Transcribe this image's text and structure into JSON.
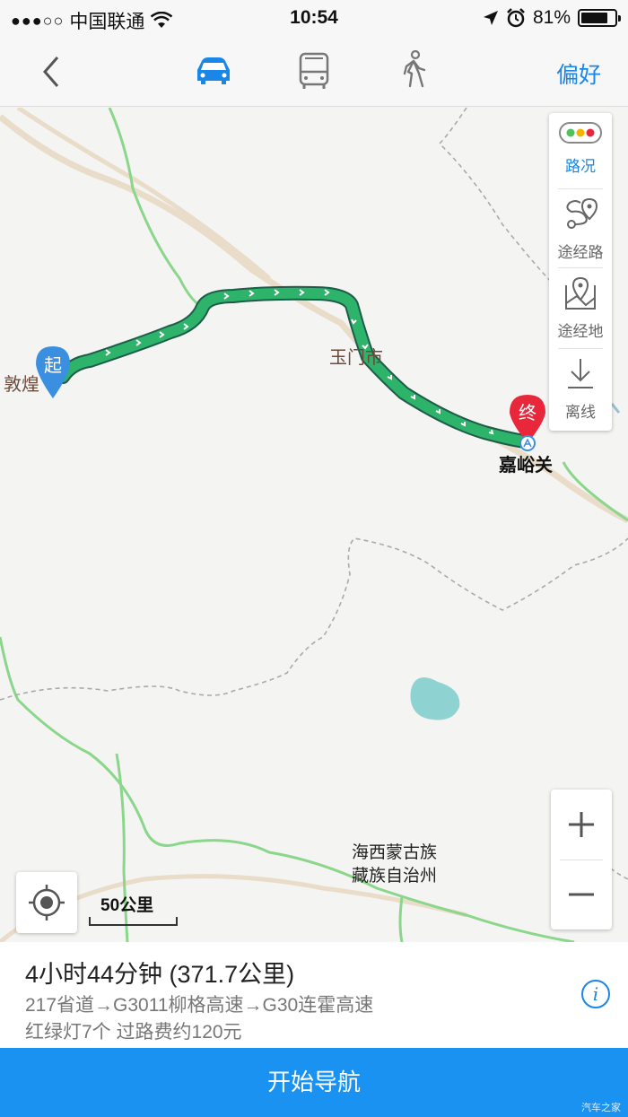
{
  "status_bar": {
    "signal": "●●●○○",
    "carrier": "中国联通",
    "time": "10:54",
    "battery_percent": "81%",
    "battery_level": 0.81
  },
  "nav": {
    "modes": [
      {
        "name": "driving",
        "icon": "car-icon",
        "active": true
      },
      {
        "name": "transit",
        "icon": "bus-icon",
        "active": false
      },
      {
        "name": "walking",
        "icon": "walk-icon",
        "active": false
      }
    ],
    "preference": "偏好"
  },
  "map": {
    "start_marker": "起",
    "end_marker": "终",
    "start_city": "敦煌",
    "mid_city": "玉门市",
    "end_city": "嘉峪关",
    "region_line1": "海西蒙古族",
    "region_line2": "藏族自治州",
    "scale": "50公里"
  },
  "toolbar": {
    "traffic": "路况",
    "via_road": "途经路",
    "via_place": "途经地",
    "offline": "离线"
  },
  "route": {
    "summary": "4小时44分钟 (371.7公里)",
    "roads": "217省道→G3011柳格高速→G30连霍高速",
    "extra": "红绿灯7个 过路费约120元"
  },
  "actions": {
    "start_navigation": "开始导航"
  },
  "watermark": "汽车之家",
  "colors": {
    "accent": "#1a87e6",
    "route_green": "#2db36a",
    "start_marker": "#3a8fe0",
    "end_marker": "#e8283a"
  }
}
